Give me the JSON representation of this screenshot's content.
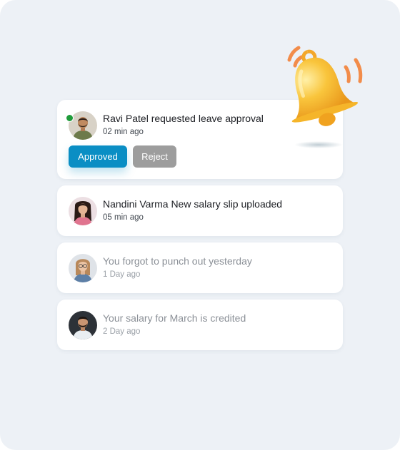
{
  "notifications": [
    {
      "title": "Ravi Patel requested leave approval",
      "time": "02 min ago",
      "online": true,
      "avatar": "avatar-ravi-patel",
      "actions": {
        "approve_label": "Approved",
        "reject_label": "Reject"
      }
    },
    {
      "title": "Nandini Varma New salary slip uploaded",
      "time": "05 min ago",
      "avatar": "avatar-nandini-varma"
    },
    {
      "title": "You forgot to punch out yesterday",
      "time": "1 Day ago",
      "avatar": "avatar-woman-glasses"
    },
    {
      "title": "Your salary for March is credited",
      "time": "2 Day ago",
      "avatar": "avatar-man-beard"
    }
  ],
  "colors": {
    "background": "#edf1f6",
    "card": "#ffffff",
    "approve_button": "#0a8ec4",
    "reject_button": "#9d9d9d",
    "online_indicator": "#1f9b3a",
    "bell": "#f6b623",
    "ring_lines": "#f28c4a"
  },
  "icons": {
    "bell": "ringing-bell-icon",
    "online": "online-status-dot"
  }
}
